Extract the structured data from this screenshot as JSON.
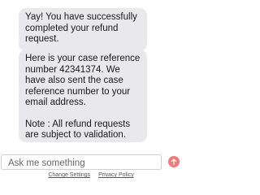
{
  "messages": [
    {
      "text": "Yay! You have successfully completed your refund request."
    },
    {
      "text": "Here is your case reference number 42341374. We have also sent the case reference number to your email address.",
      "note": "Note : All refund requests are subject to validation."
    }
  ],
  "input": {
    "placeholder": "Ask me something"
  },
  "send_button": {
    "icon": "arrow-up-icon",
    "color": "#f07a7a"
  },
  "footer": {
    "links": [
      {
        "label": "Change Settings"
      },
      {
        "label": "Privacy Policy"
      }
    ]
  },
  "colors": {
    "bubble_bg": "#e9e9eb",
    "accent": "#f07a7a"
  }
}
